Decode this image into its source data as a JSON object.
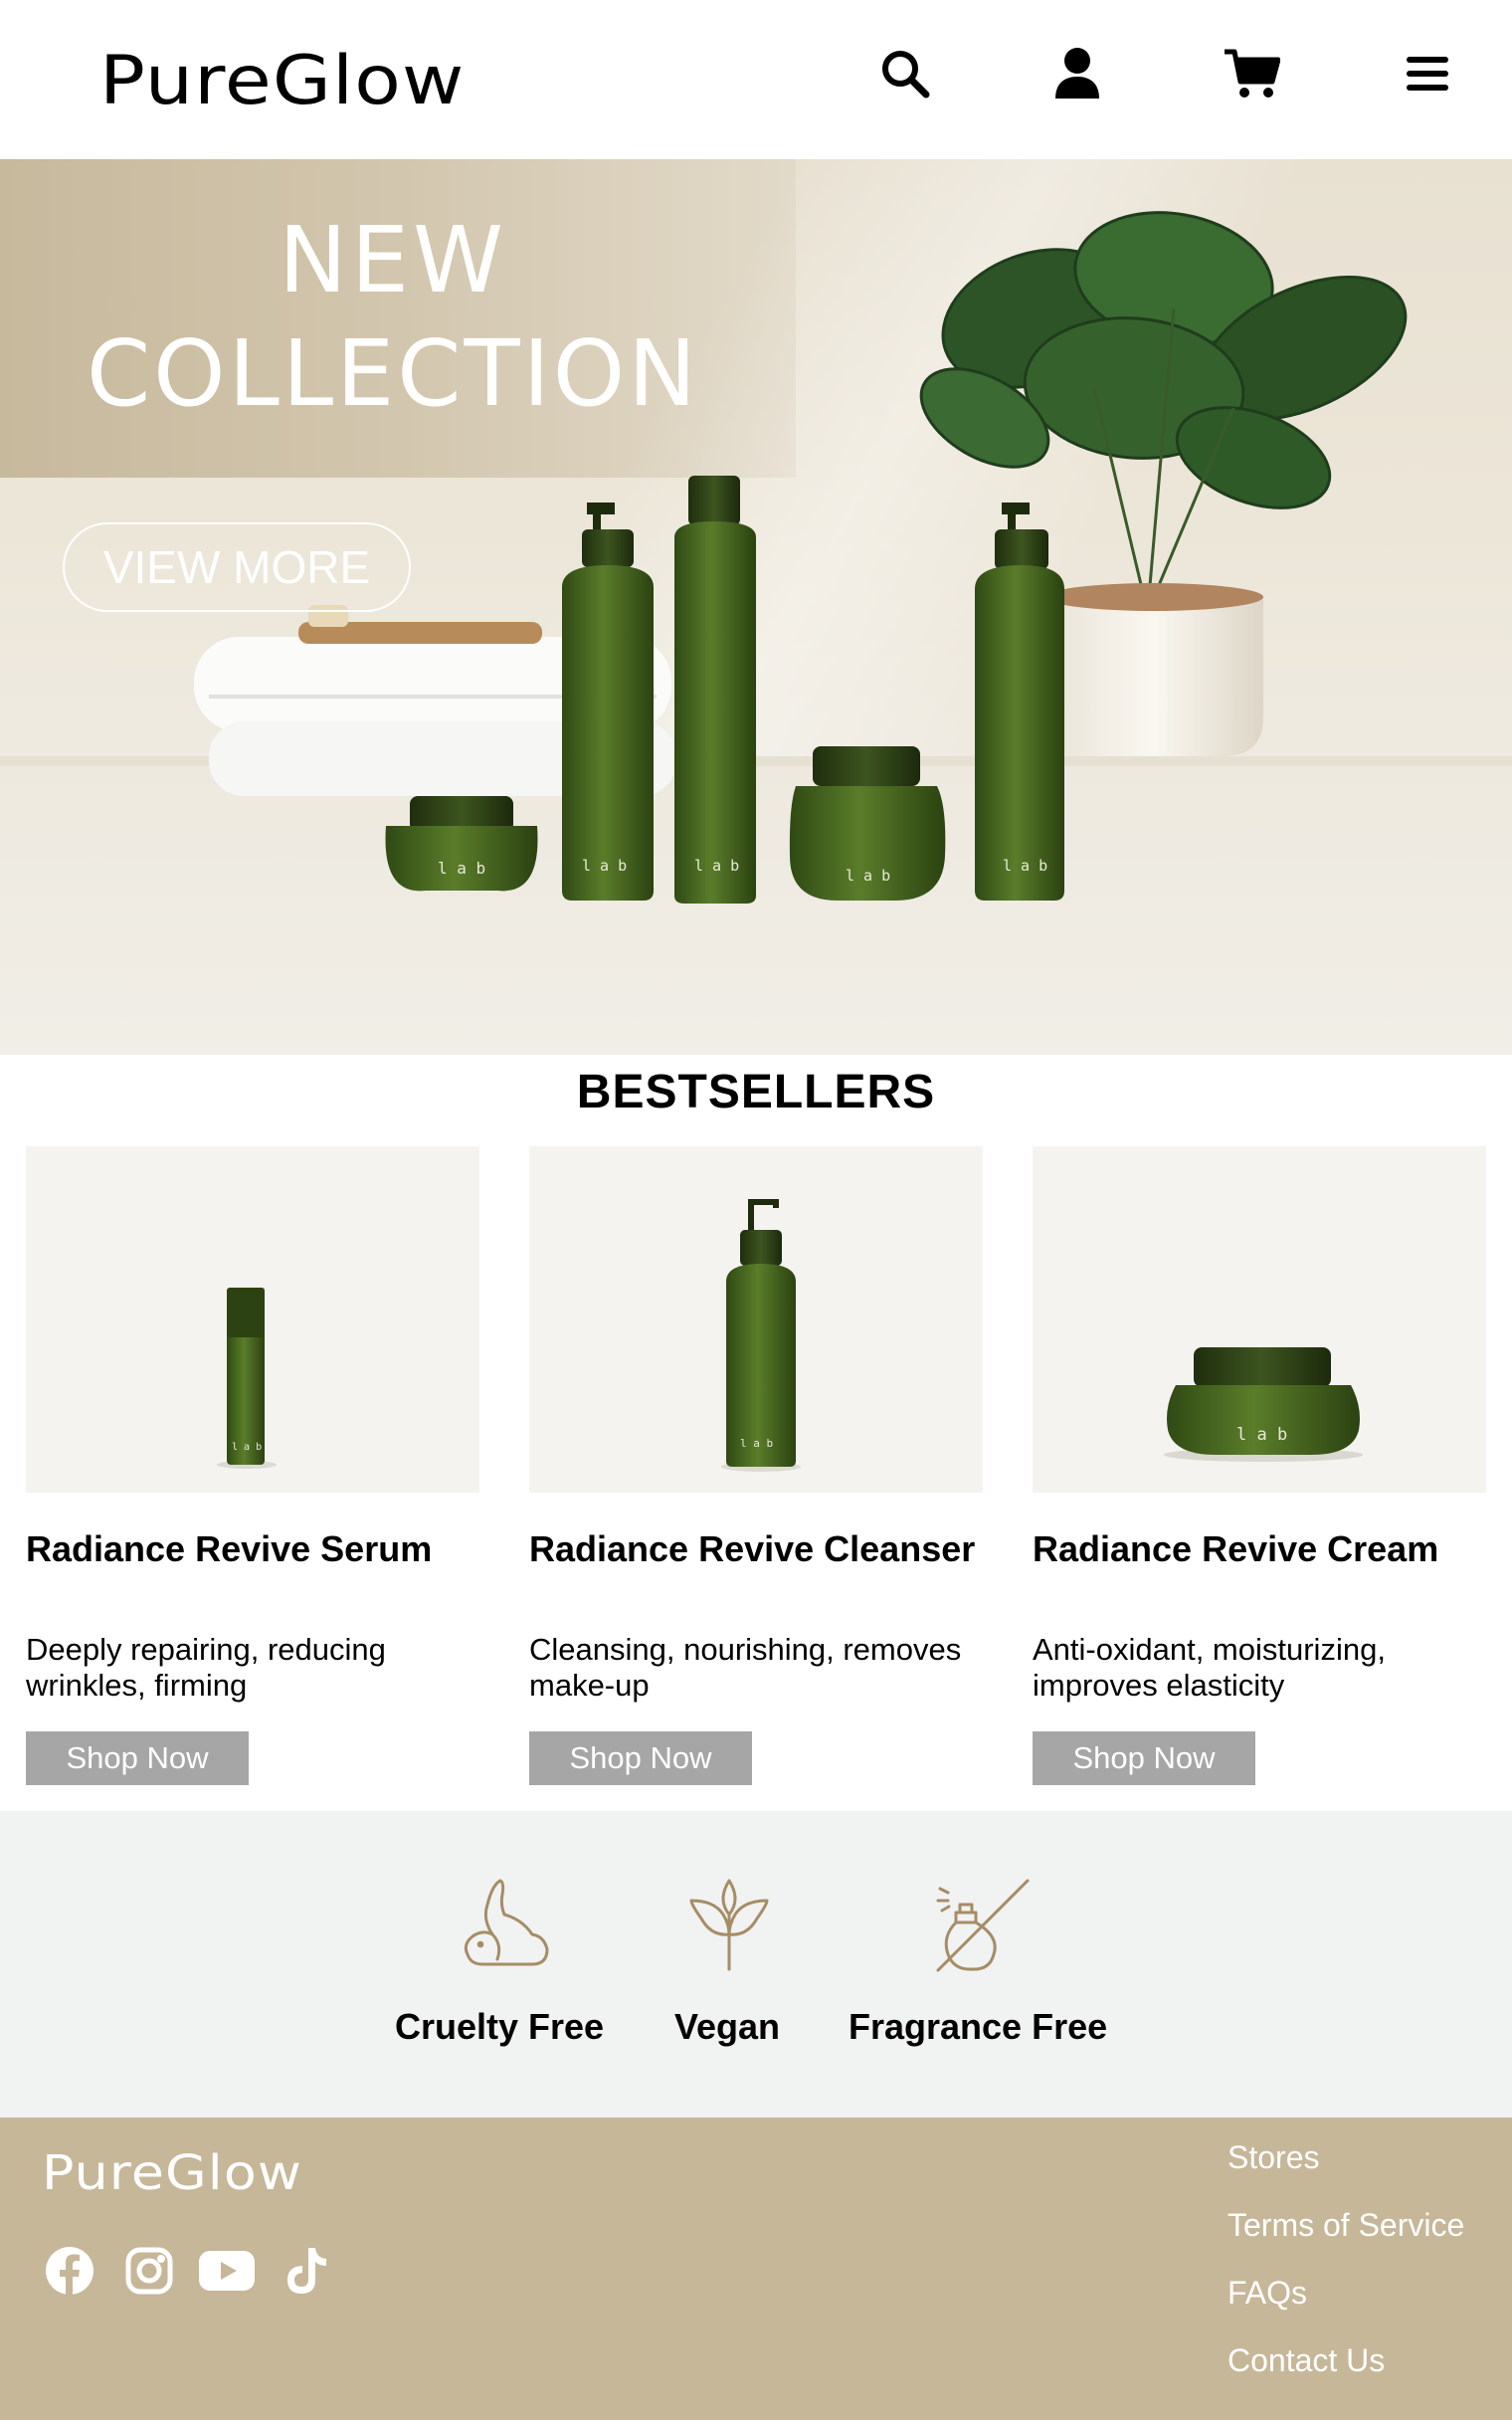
{
  "header": {
    "brand": "PureGlow",
    "icons": [
      "search-icon",
      "user-icon",
      "cart-icon",
      "menu-icon"
    ]
  },
  "hero": {
    "title_line1": "NEW",
    "title_line2": "COLLECTION",
    "cta_label": "VIEW MORE"
  },
  "bestsellers": {
    "title": "BESTSELLERS",
    "products": [
      {
        "name": "Radiance Revive Serum",
        "description": "Deeply repairing, reducing wrinkles, firming",
        "button": "Shop Now"
      },
      {
        "name": "Radiance Revive Cleanser",
        "description": "Cleansing, nourishing, removes make-up",
        "button": "Shop Now"
      },
      {
        "name": "Radiance Revive Cream",
        "description": "Anti-oxidant, moisturizing, improves elasticity",
        "button": "Shop Now"
      }
    ]
  },
  "features": [
    {
      "label": "Cruelty Free",
      "icon": "rabbit-icon"
    },
    {
      "label": "Vegan",
      "icon": "leaf-icon"
    },
    {
      "label": "Fragrance Free",
      "icon": "no-fragrance-icon"
    }
  ],
  "footer": {
    "brand": "PureGlow",
    "social": [
      "facebook-icon",
      "instagram-icon",
      "youtube-icon",
      "tiktok-icon"
    ],
    "links": [
      "Stores",
      "Terms of Service",
      "FAQs",
      "Contact Us"
    ]
  },
  "colors": {
    "accent_gold": "#c6b799",
    "button_gray": "#a6a6a6",
    "product_green": "#4b6b23",
    "icon_tan": "#a58d66"
  }
}
